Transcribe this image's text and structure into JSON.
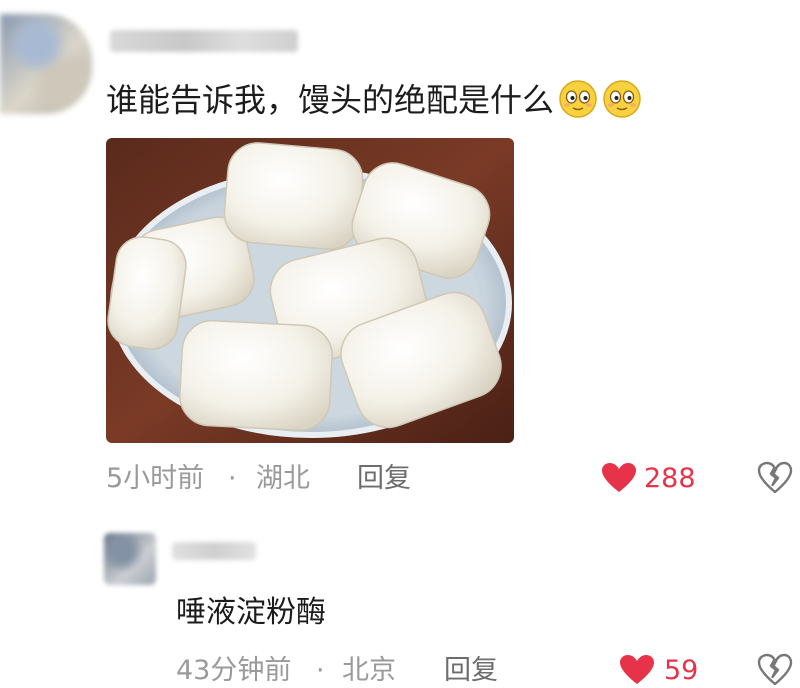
{
  "comment": {
    "text": "谁能告诉我，馒头的绝配是什么",
    "emojis": [
      "smile-emoji",
      "smile-emoji"
    ],
    "image": "steamed-buns-photo",
    "time": "5小时前",
    "separator": "·",
    "location": "湖北",
    "reply_label": "回复",
    "likes": "288"
  },
  "reply": {
    "text": "唾液淀粉酶",
    "time": "43分钟前",
    "separator": "·",
    "location": "北京",
    "reply_label": "回复",
    "likes": "59"
  },
  "colors": {
    "like": "#e6334a",
    "meta": "#9a9a9a",
    "reply_link": "#6d6d6d"
  }
}
